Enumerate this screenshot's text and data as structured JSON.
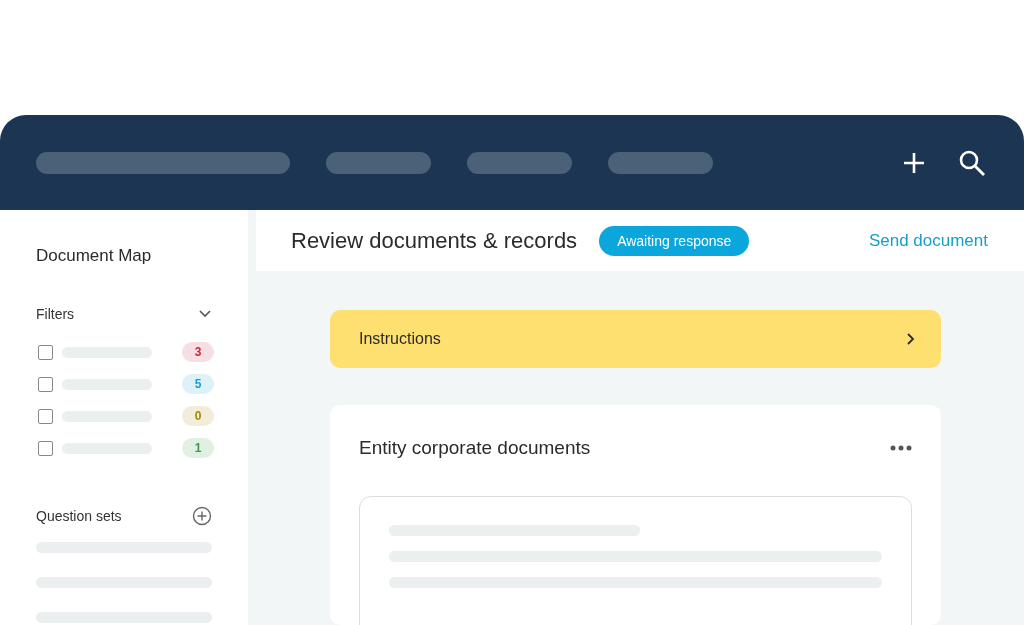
{
  "sidebar": {
    "title": "Document Map",
    "filters": {
      "label": "Filters",
      "expanded": true,
      "items": [
        {
          "checked": false,
          "count": "3",
          "color": "#c4283f"
        },
        {
          "checked": false,
          "count": "5",
          "color": "#1a9fd0"
        },
        {
          "checked": false,
          "count": "0",
          "color": "#a8870a"
        },
        {
          "checked": false,
          "count": "1",
          "color": "#3a9a4c"
        }
      ]
    },
    "question_sets": {
      "label": "Question sets"
    }
  },
  "main": {
    "title": "Review documents & records",
    "status": "Awaiting response",
    "action": "Send document",
    "instructions": {
      "label": "Instructions"
    },
    "card": {
      "title": "Entity corporate documents"
    }
  }
}
